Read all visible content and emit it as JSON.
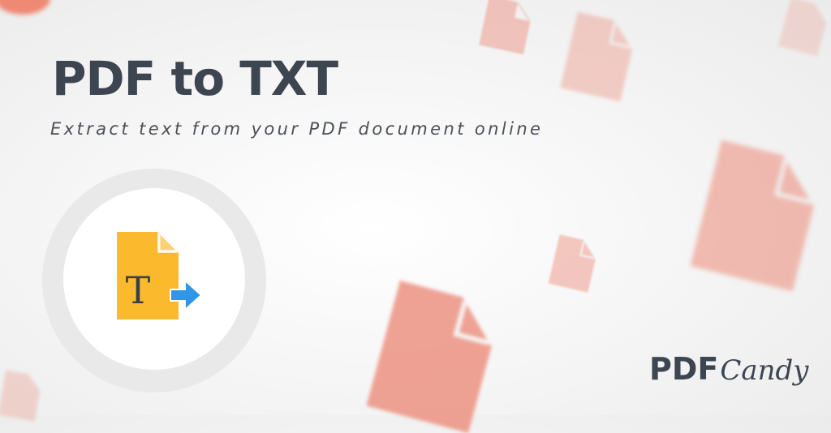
{
  "hero": {
    "title": "PDF to TXT",
    "subtitle": "Extract text from your PDF document online"
  },
  "tool_icon": {
    "name": "pdf-to-txt-icon",
    "glyph": "T",
    "colors": {
      "document": "#fbb92d",
      "arrow": "#2f96ea",
      "glyph": "#3b3f45"
    }
  },
  "brand": {
    "logo_part1": "PDF",
    "logo_part2": "Candy"
  },
  "decoration": {
    "document_icon_color": "#ec8a78"
  }
}
